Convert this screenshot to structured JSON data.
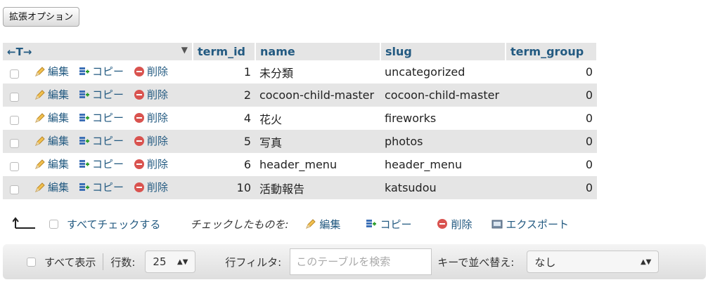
{
  "options_button": "拡張オプション",
  "header": {
    "arrows": "←T→",
    "columns": [
      "term_id",
      "name",
      "slug",
      "term_group"
    ]
  },
  "actions": {
    "edit": "編集",
    "copy": "コピー",
    "delete": "削除"
  },
  "rows": [
    {
      "term_id": "1",
      "name": "未分類",
      "slug": "uncategorized",
      "term_group": "0"
    },
    {
      "term_id": "2",
      "name": "cocoon-child-master",
      "slug": "cocoon-child-master",
      "term_group": "0"
    },
    {
      "term_id": "4",
      "name": "花火",
      "slug": "fireworks",
      "term_group": "0"
    },
    {
      "term_id": "5",
      "name": "写真",
      "slug": "photos",
      "term_group": "0"
    },
    {
      "term_id": "6",
      "name": "header_menu",
      "slug": "header_menu",
      "term_group": "0"
    },
    {
      "term_id": "10",
      "name": "活動報告",
      "slug": "katsudou",
      "term_group": "0"
    }
  ],
  "bulk": {
    "check_all": "すべてチェックする",
    "with_selected": "チェックしたものを:",
    "edit": "編集",
    "copy": "コピー",
    "delete": "削除",
    "export": "エクスポート"
  },
  "nav": {
    "show_all": "すべて表示",
    "rows_label": "行数:",
    "rows_value": "25",
    "filter_label": "行フィルタ:",
    "filter_placeholder": "このテーブルを検索",
    "sort_label": "キーで並べ替え:",
    "sort_value": "なし"
  },
  "colors": {
    "link": "#235a81",
    "stripe": "#e5e5e5",
    "delete": "#d9534f"
  }
}
